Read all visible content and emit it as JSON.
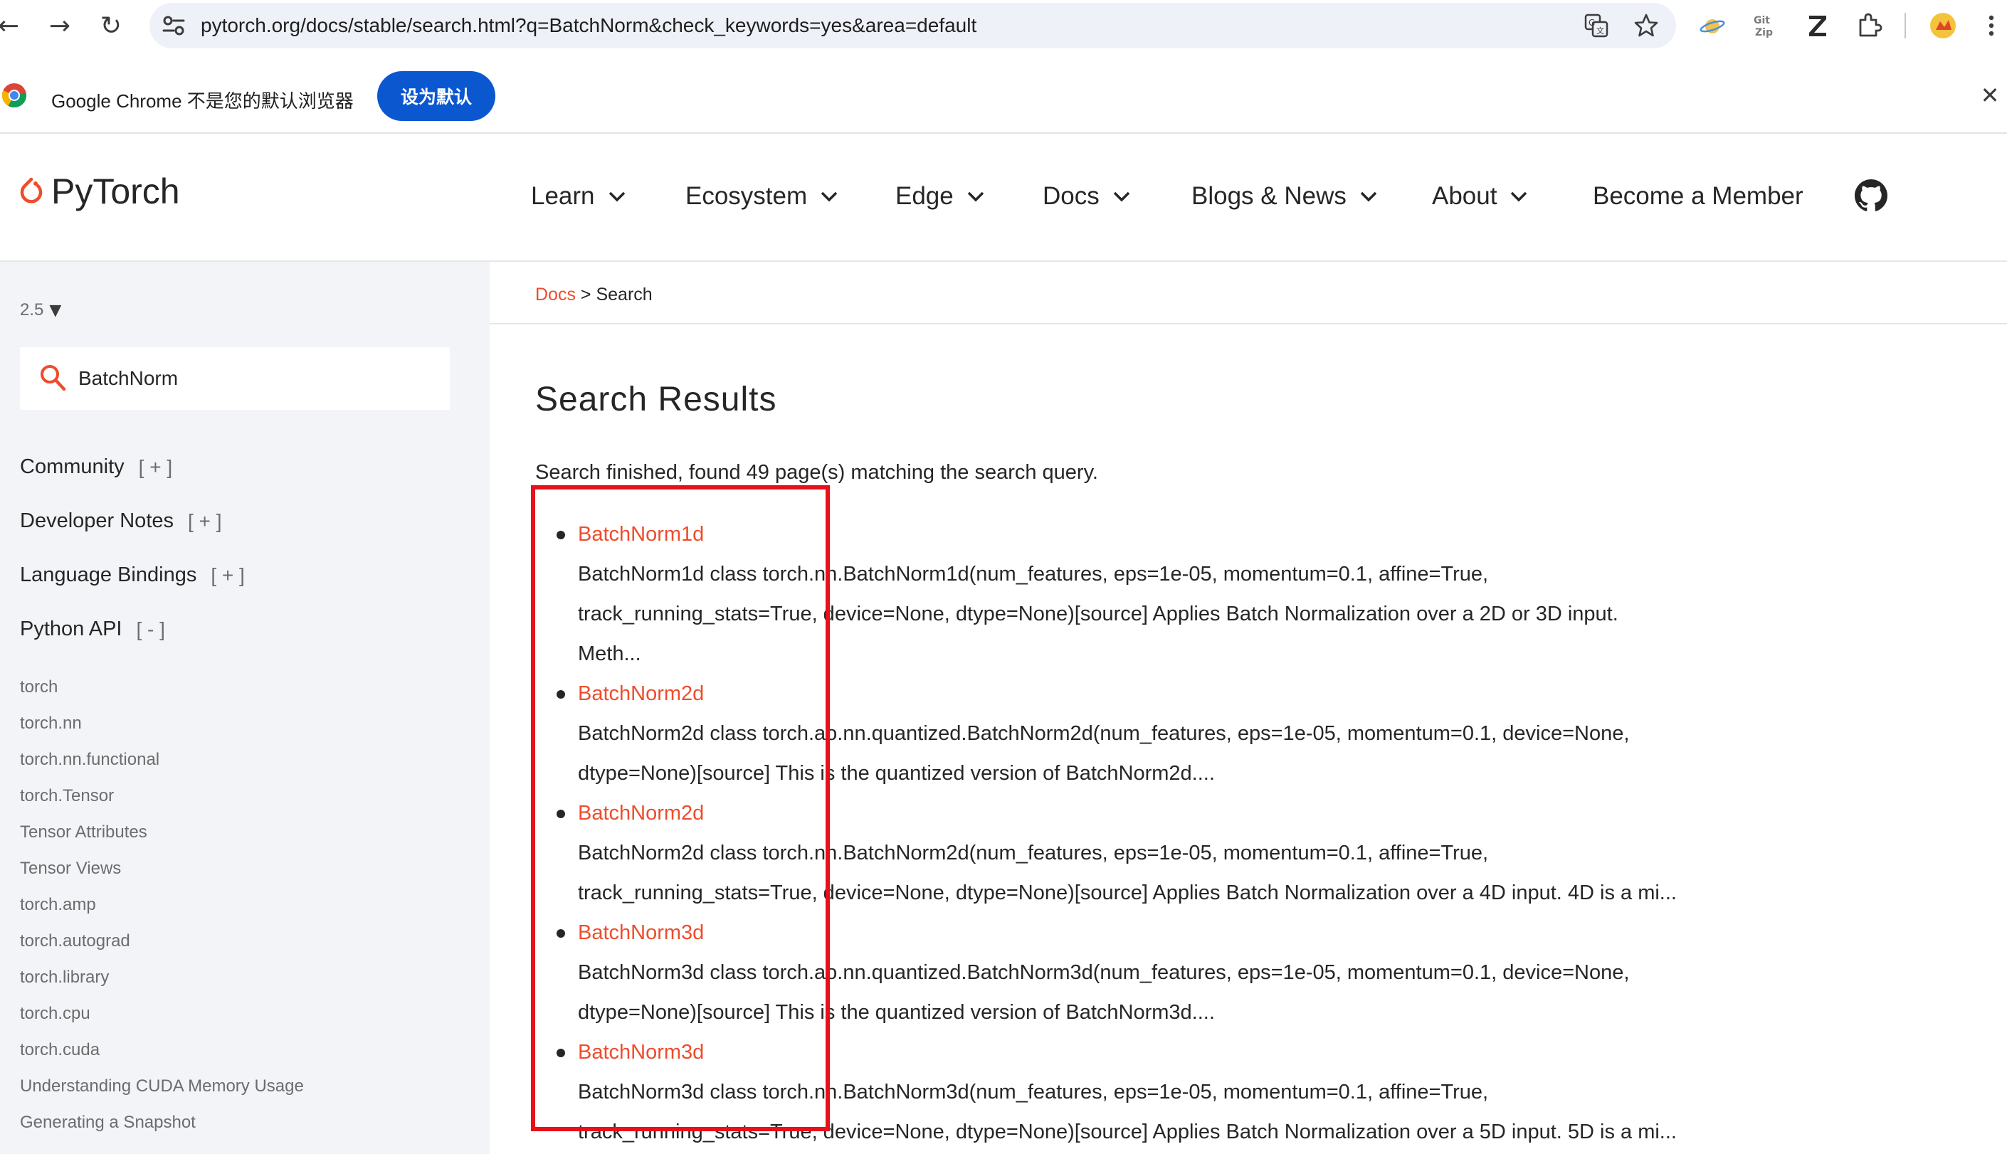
{
  "browser": {
    "url": "pytorch.org/docs/stable/search.html?q=BatchNorm&check_keywords=yes&area=default",
    "back_icon": "←",
    "forward_icon": "→",
    "reload_icon": "↻"
  },
  "infobar": {
    "message": "Google Chrome 不是您的默认浏览器",
    "set_default_label": "设为默认",
    "close_icon": "✕"
  },
  "header": {
    "logo_text": "PyTorch",
    "nav": [
      {
        "label": "Learn"
      },
      {
        "label": "Ecosystem"
      },
      {
        "label": "Edge"
      },
      {
        "label": "Docs"
      },
      {
        "label": "Blogs & News"
      },
      {
        "label": "About"
      },
      {
        "label": "Become a Member"
      }
    ]
  },
  "sidebar": {
    "version": "2.5",
    "version_caret": "▼",
    "search_value": "BatchNorm",
    "sections": [
      {
        "label": "Community",
        "toggle": "[ + ]"
      },
      {
        "label": "Developer Notes",
        "toggle": "[ + ]"
      },
      {
        "label": "Language Bindings",
        "toggle": "[ + ]"
      },
      {
        "label": "Python API",
        "toggle": "[ - ]"
      }
    ],
    "links": [
      "torch",
      "torch.nn",
      "torch.nn.functional",
      "torch.Tensor",
      "Tensor Attributes",
      "Tensor Views",
      "torch.amp",
      "torch.autograd",
      "torch.library",
      "torch.cpu",
      "torch.cuda",
      "Understanding CUDA Memory Usage",
      "Generating a Snapshot"
    ]
  },
  "breadcrumb": {
    "link": "Docs",
    "separator": " > ",
    "current": "Search"
  },
  "main": {
    "title": "Search Results",
    "summary": "Search finished, found 49 page(s) matching the search query.",
    "results": [
      {
        "title": "BatchNorm1d",
        "lines": [
          "BatchNorm1d class torch.nn.BatchNorm1d(num_features, eps=1e-05, momentum=0.1, affine=True,",
          "track_running_stats=True, device=None, dtype=None)[source] Applies Batch Normalization over a 2D or 3D input.",
          "Meth..."
        ]
      },
      {
        "title": "BatchNorm2d",
        "lines": [
          "BatchNorm2d class torch.ao.nn.quantized.BatchNorm2d(num_features, eps=1e-05, momentum=0.1, device=None,",
          "dtype=None)[source] This is the quantized version of BatchNorm2d...."
        ]
      },
      {
        "title": "BatchNorm2d",
        "lines": [
          "BatchNorm2d class torch.nn.BatchNorm2d(num_features, eps=1e-05, momentum=0.1, affine=True,",
          "track_running_stats=True, device=None, dtype=None)[source] Applies Batch Normalization over a 4D input. 4D is a mi..."
        ]
      },
      {
        "title": "BatchNorm3d",
        "lines": [
          "BatchNorm3d class torch.ao.nn.quantized.BatchNorm3d(num_features, eps=1e-05, momentum=0.1, device=None,",
          "dtype=None)[source] This is the quantized version of BatchNorm3d...."
        ]
      },
      {
        "title": "BatchNorm3d",
        "lines": [
          "BatchNorm3d class torch.nn.BatchNorm3d(num_features, eps=1e-05, momentum=0.1, affine=True,",
          "track_running_stats=True, device=None, dtype=None)[source] Applies Batch Normalization over a 5D input. 5D is a mi..."
        ]
      }
    ]
  },
  "colors": {
    "accent": "#ee4c2c",
    "annotation_box": "#e8101a",
    "chrome_blue": "#0b57d0"
  }
}
